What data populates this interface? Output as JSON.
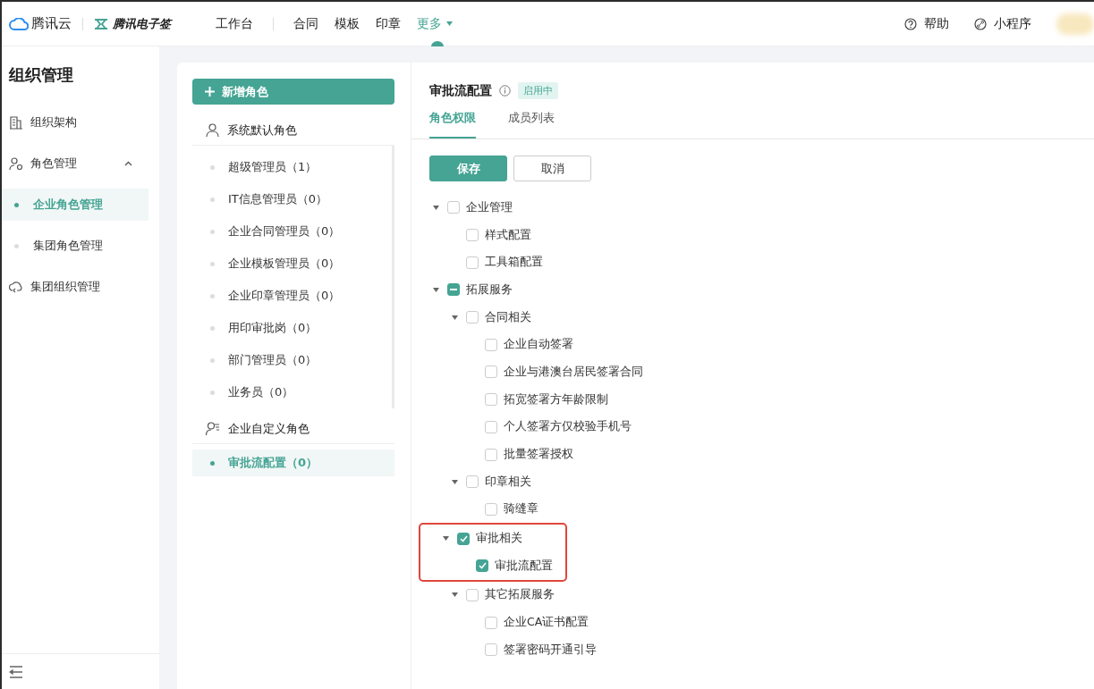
{
  "topbar": {
    "brand": "腾讯云",
    "product": "腾讯电子签",
    "nav": [
      {
        "label": "工作台",
        "selected": false,
        "dropdown": false
      },
      {
        "label": "合同",
        "selected": false,
        "dropdown": false
      },
      {
        "label": "模板",
        "selected": false,
        "dropdown": false
      },
      {
        "label": "印章",
        "selected": false,
        "dropdown": false
      },
      {
        "label": "更多",
        "selected": true,
        "dropdown": true
      }
    ],
    "help": "帮助",
    "miniapp": "小程序"
  },
  "sidebar": {
    "title": "组织管理",
    "items": [
      {
        "label": "组织架构",
        "kind": "org",
        "selected": false
      },
      {
        "label": "角色管理",
        "kind": "group",
        "selected": false,
        "expanded": true,
        "children": [
          {
            "label": "企业角色管理",
            "selected": true
          },
          {
            "label": "集团角色管理",
            "selected": false
          }
        ]
      },
      {
        "label": "集团组织管理",
        "kind": "group-org",
        "selected": false
      }
    ]
  },
  "roles": {
    "add_button": "新增角色",
    "groups": [
      {
        "title": "系统默认角色",
        "kind": "system",
        "items": [
          {
            "label": "超级管理员（1）",
            "selected": false
          },
          {
            "label": "IT信息管理员（0）",
            "selected": false
          },
          {
            "label": "企业合同管理员（0）",
            "selected": false
          },
          {
            "label": "企业模板管理员（0）",
            "selected": false
          },
          {
            "label": "企业印章管理员（0）",
            "selected": false
          },
          {
            "label": "用印审批岗（0）",
            "selected": false
          },
          {
            "label": "部门管理员（0）",
            "selected": false
          },
          {
            "label": "业务员（0）",
            "selected": false
          }
        ]
      },
      {
        "title": "企业自定义角色",
        "kind": "custom",
        "items": [
          {
            "label": "审批流配置（0）",
            "selected": true
          }
        ]
      }
    ]
  },
  "detail": {
    "title": "审批流配置",
    "status": "启用中",
    "tabs": [
      {
        "label": "角色权限",
        "selected": true
      },
      {
        "label": "成员列表",
        "selected": false
      }
    ],
    "save": "保存",
    "cancel": "取消",
    "tree": [
      {
        "label": "企业管理",
        "checked": false,
        "indeterminate": false,
        "expanded": true,
        "children": [
          {
            "label": "样式配置",
            "checked": false,
            "indeterminate": false
          },
          {
            "label": "工具箱配置",
            "checked": false,
            "indeterminate": false
          }
        ]
      },
      {
        "label": "拓展服务",
        "checked": false,
        "indeterminate": true,
        "expanded": true,
        "children": [
          {
            "label": "合同相关",
            "checked": false,
            "indeterminate": false,
            "expanded": true,
            "children": [
              {
                "label": "企业自动签署",
                "checked": false,
                "indeterminate": false
              },
              {
                "label": "企业与港澳台居民签署合同",
                "checked": false,
                "indeterminate": false
              },
              {
                "label": "拓宽签署方年龄限制",
                "checked": false,
                "indeterminate": false
              },
              {
                "label": "个人签署方仅校验手机号",
                "checked": false,
                "indeterminate": false
              },
              {
                "label": "批量签署授权",
                "checked": false,
                "indeterminate": false
              }
            ]
          },
          {
            "label": "印章相关",
            "checked": false,
            "indeterminate": false,
            "expanded": true,
            "children": [
              {
                "label": "骑缝章",
                "checked": false,
                "indeterminate": false
              }
            ]
          },
          {
            "label": "审批相关",
            "checked": true,
            "indeterminate": false,
            "expanded": true,
            "highlighted": true,
            "children": [
              {
                "label": "审批流配置",
                "checked": true,
                "indeterminate": false
              }
            ]
          },
          {
            "label": "其它拓展服务",
            "checked": false,
            "indeterminate": false,
            "expanded": true,
            "children": [
              {
                "label": "企业CA证书配置",
                "checked": false,
                "indeterminate": false
              },
              {
                "label": "签署密码开通引导",
                "checked": false,
                "indeterminate": false
              }
            ]
          }
        ]
      }
    ]
  }
}
